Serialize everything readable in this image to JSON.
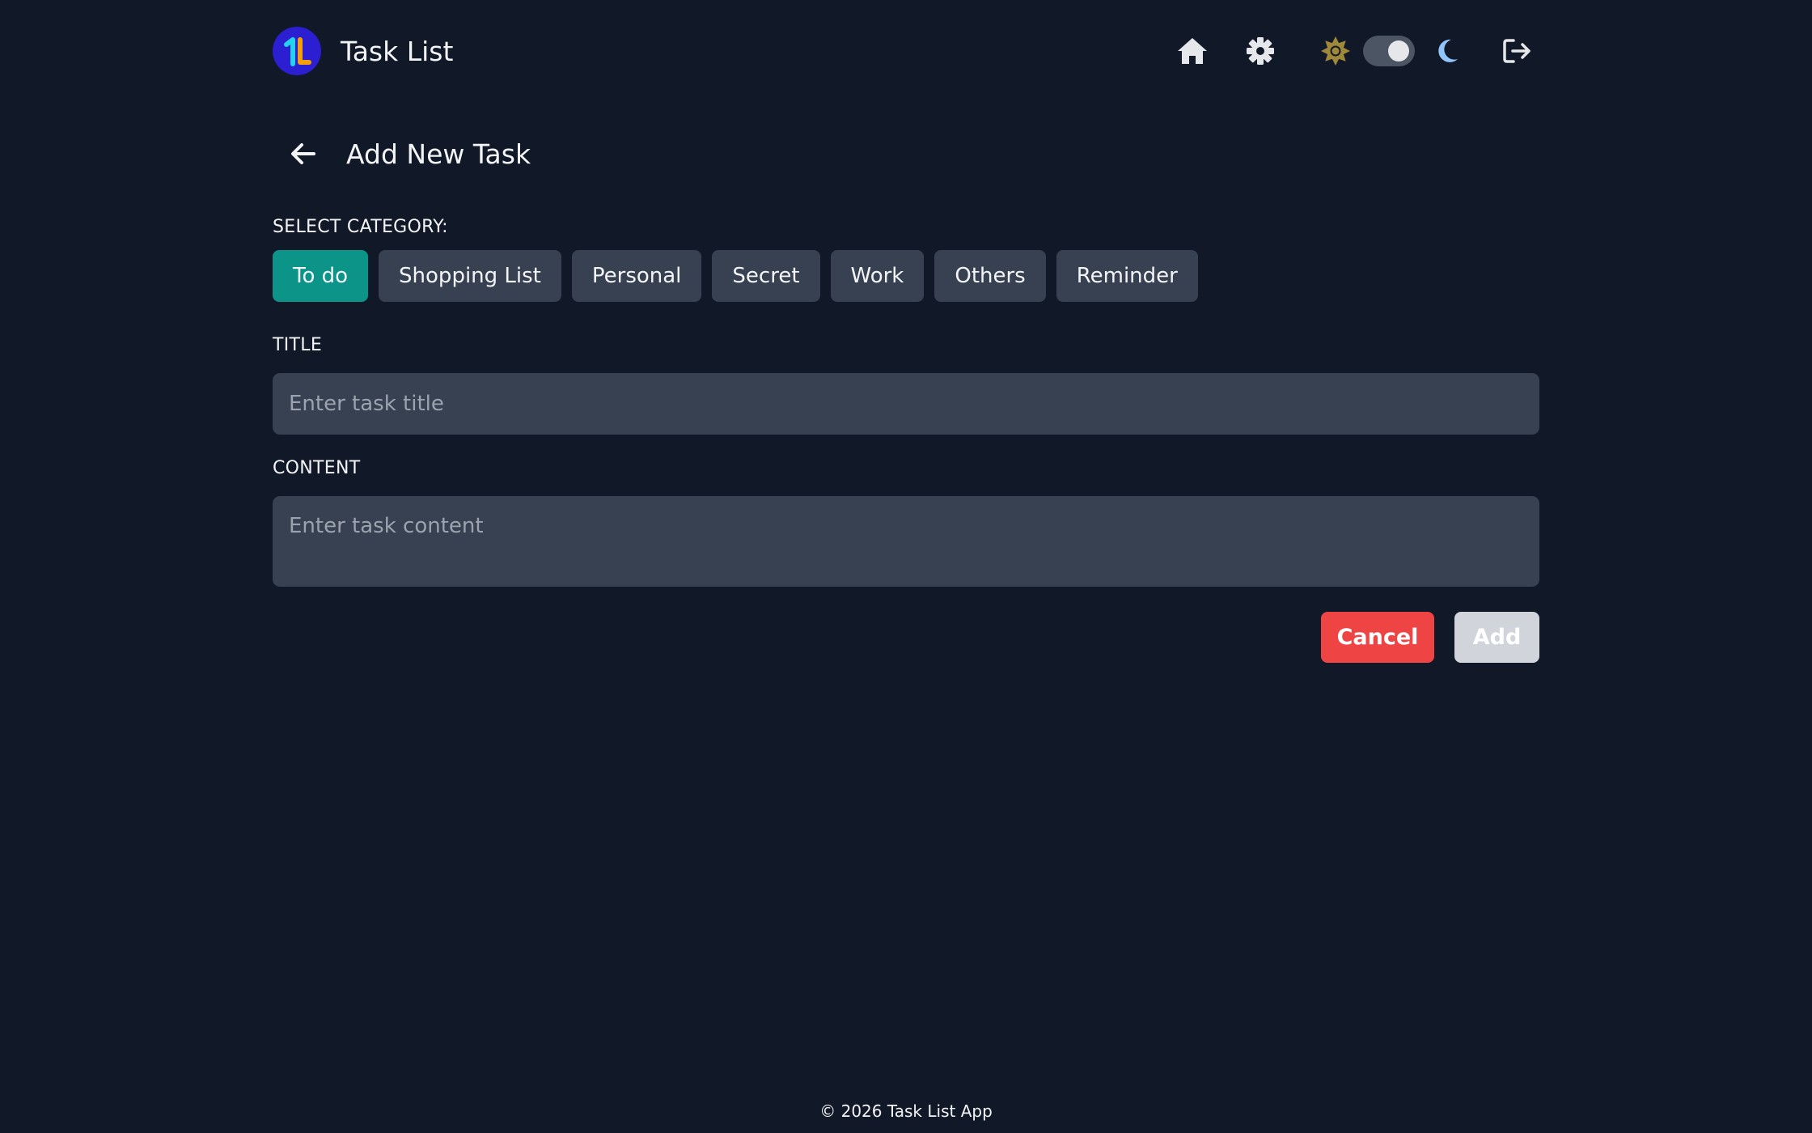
{
  "header": {
    "app_title": "Task List",
    "icons": {
      "logo": "task-list-logo",
      "home": "home-icon",
      "settings": "gear-icon",
      "light_mode": "sun-icon",
      "dark_mode": "moon-icon",
      "logout": "logout-icon"
    },
    "theme_toggle": "dark"
  },
  "page": {
    "title": "Add New Task",
    "back_icon": "arrow-left-icon"
  },
  "form": {
    "category_label": "SELECT CATEGORY:",
    "categories": [
      {
        "label": "To do",
        "selected": true
      },
      {
        "label": "Shopping List",
        "selected": false
      },
      {
        "label": "Personal",
        "selected": false
      },
      {
        "label": "Secret",
        "selected": false
      },
      {
        "label": "Work",
        "selected": false
      },
      {
        "label": "Others",
        "selected": false
      },
      {
        "label": "Reminder",
        "selected": false
      }
    ],
    "title_label": "TITLE",
    "title_value": "",
    "title_placeholder": "Enter task title",
    "content_label": "CONTENT",
    "content_value": "",
    "content_placeholder": "Enter task content",
    "cancel_label": "Cancel",
    "add_label": "Add"
  },
  "footer": {
    "text": "© 2026 Task List App"
  },
  "colors": {
    "background": "#111827",
    "chip": "#374151",
    "chip_selected": "#0d9488",
    "input_bg": "#374151",
    "cancel": "#ef4444",
    "add_disabled": "#d1d5db",
    "sun": "#a0883a",
    "moon": "#93c5fd",
    "logo_bg": "#2b1fd1"
  }
}
